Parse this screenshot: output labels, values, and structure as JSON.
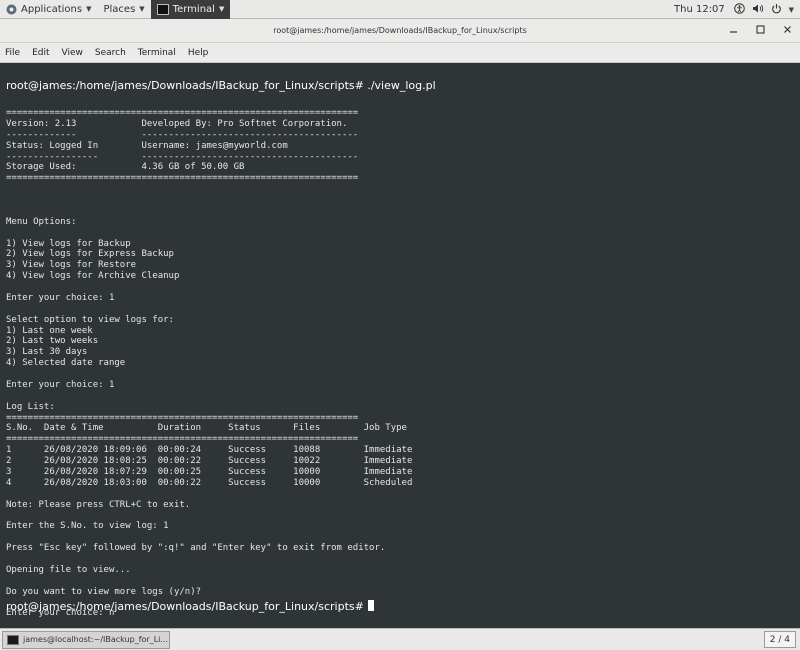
{
  "topbar": {
    "applications_label": "Applications",
    "places_label": "Places",
    "active_app_label": "Terminal",
    "clock": "Thu 12:07"
  },
  "window": {
    "title": "root@james:/home/james/Downloads/IBackup_for_Linux/scripts"
  },
  "menubar": {
    "items": [
      "File",
      "Edit",
      "View",
      "Search",
      "Terminal",
      "Help"
    ]
  },
  "terminal": {
    "prompt_top": "root@james:/home/james/Downloads/IBackup_for_Linux/scripts# ./view_log.pl",
    "output": "=================================================================\nVersion: 2.13            Developed By: Pro Softnet Corporation.\n-------------            ----------------------------------------\nStatus: Logged In        Username: james@myworld.com\n-----------------        ----------------------------------------\nStorage Used:            4.36 GB of 50.00 GB\n=================================================================\n\n\n\nMenu Options:\n\n1) View logs for Backup\n2) View logs for Express Backup\n3) View logs for Restore\n4) View logs for Archive Cleanup\n\nEnter your choice: 1\n\nSelect option to view logs for:\n1) Last one week\n2) Last two weeks\n3) Last 30 days\n4) Selected date range\n\nEnter your choice: 1\n\nLog List:\n=================================================================\nS.No.  Date & Time          Duration     Status      Files        Job Type\n=================================================================\n1      26/08/2020 18:09:06  00:00:24     Success     10088        Immediate\n2      26/08/2020 18:08:25  00:00:22     Success     10022        Immediate\n3      26/08/2020 18:07:29  00:00:25     Success     10000        Immediate\n4      26/08/2020 18:03:00  00:00:22     Success     10000        Scheduled\n\nNote: Please press CTRL+C to exit.\n\nEnter the S.No. to view log: 1\n\nPress \"Esc key\" followed by \":q!\" and \"Enter key\" to exit from editor.\n\nOpening file to view...\n\nDo you want to view more logs (y/n)?\n\nEnter your choice: n",
    "prompt_bottom": "root@james:/home/james/Downloads/IBackup_for_Linux/scripts#"
  },
  "taskbar": {
    "task_label": "james@localhost:~/IBackup_for_Li...",
    "workspace": "2 / 4"
  }
}
